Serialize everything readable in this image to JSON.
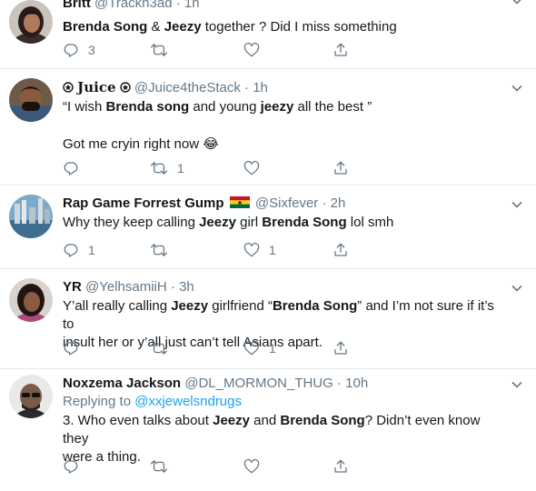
{
  "tweets": [
    {
      "name": "Britt",
      "handle": "@Trackh3ad",
      "time": "1h",
      "text": [
        [
          "b",
          "Brenda Song"
        ],
        [
          "t",
          " & "
        ],
        [
          "b",
          "Jeezy"
        ],
        [
          "t",
          " together ? Did I miss something"
        ]
      ],
      "replies": "3",
      "retweets": "",
      "likes": ""
    },
    {
      "name": "Juice",
      "handle": "@Juice4theStack",
      "time": "1h",
      "text1": [
        [
          "t",
          "“I wish "
        ],
        [
          "b",
          "Brenda song"
        ],
        [
          "t",
          " and young "
        ],
        [
          "b",
          "jeezy"
        ],
        [
          "t",
          " all the best ”"
        ]
      ],
      "text2": "Got me cryin right now 😂",
      "replies": "",
      "retweets": "1",
      "likes": ""
    },
    {
      "name": "Rap Game Forrest Gump",
      "handle": "@Sixfever",
      "time": "2h",
      "text": [
        [
          "t",
          "Why they keep calling "
        ],
        [
          "b",
          "Jeezy"
        ],
        [
          "t",
          " girl "
        ],
        [
          "b",
          "Brenda Song"
        ],
        [
          "t",
          " lol smh"
        ]
      ],
      "replies": "1",
      "retweets": "",
      "likes": "1"
    },
    {
      "name": "YR",
      "handle": "@YelhsamiiH",
      "time": "3h",
      "line1": [
        [
          "t",
          "Y’all really calling "
        ],
        [
          "b",
          "Jeezy"
        ],
        [
          "t",
          " girlfriend “"
        ],
        [
          "b",
          "Brenda Song"
        ],
        [
          "t",
          "” and I’m not sure if it’s to"
        ]
      ],
      "line2": "insult her or y’all just can’t tell Asians apart.",
      "replies": "",
      "retweets": "",
      "likes": "1"
    },
    {
      "name": "Noxzema Jackson",
      "handle": "@DL_MORMON_THUG",
      "time": "10h",
      "replying_label": "Replying to",
      "replying_to": "@xxjewelsndrugs",
      "line1": [
        [
          "t",
          "3. Who even talks about "
        ],
        [
          "b",
          "Jeezy"
        ],
        [
          "t",
          " and "
        ],
        [
          "b",
          "Brenda Song"
        ],
        [
          "t",
          "? Didn’t even know they"
        ]
      ],
      "line2": "were a thing.",
      "replies": "",
      "retweets": "",
      "likes": ""
    }
  ],
  "icons": {
    "reply": "reply-icon",
    "retweet": "retweet-icon",
    "like": "heart-icon",
    "share": "share-icon",
    "more": "chevron-down-icon",
    "badge": "badge-icon",
    "flag": "ghana-flag-icon"
  },
  "colors": {
    "text": "#14171a",
    "secondary": "#657786",
    "link": "#1da1f2",
    "divider": "#e6ecf0"
  }
}
